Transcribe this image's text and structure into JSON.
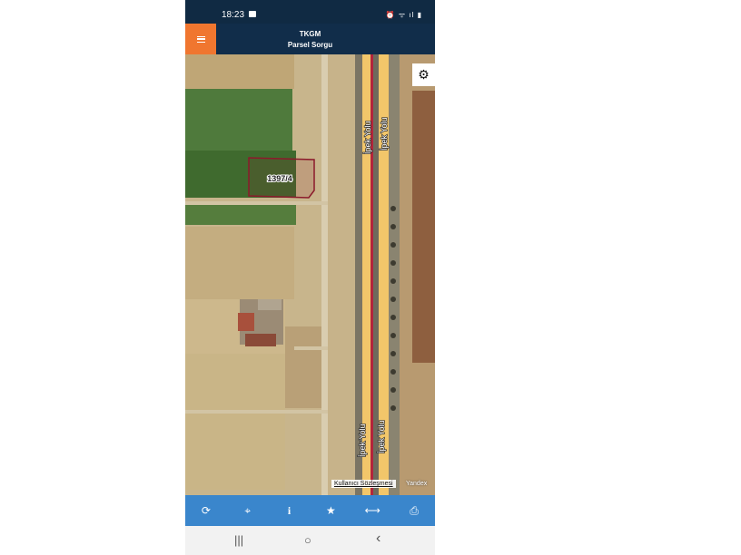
{
  "status": {
    "time": "18:23",
    "icons": "⏰ ᯤ ıl ▮"
  },
  "header": {
    "title": "TKGM",
    "subtitle": "Parsel Sorgu"
  },
  "map": {
    "parcel_label": "1397/4",
    "road_labels": [
      "İpek Yolu",
      "İpek Yolu",
      "İpek Yolu",
      "İpek Yolu"
    ],
    "agreement_link": "Kullanıcı Sözleşmesi",
    "provider": "Yandex"
  },
  "toolbar": {
    "icons": [
      "refresh-icon",
      "locate-icon",
      "info-icon",
      "star-icon",
      "measure-icon",
      "print-icon"
    ],
    "glyphs": [
      "⟳",
      "⌖",
      "i",
      "★",
      "⟷",
      "⎙"
    ]
  },
  "navbar": {
    "recent": "|||",
    "home": "○",
    "back": "‹"
  },
  "colors": {
    "header": "#112d4a",
    "menu": "#f0762f",
    "toolbar": "#3a86cc",
    "parcel": "#8b1a2b"
  }
}
